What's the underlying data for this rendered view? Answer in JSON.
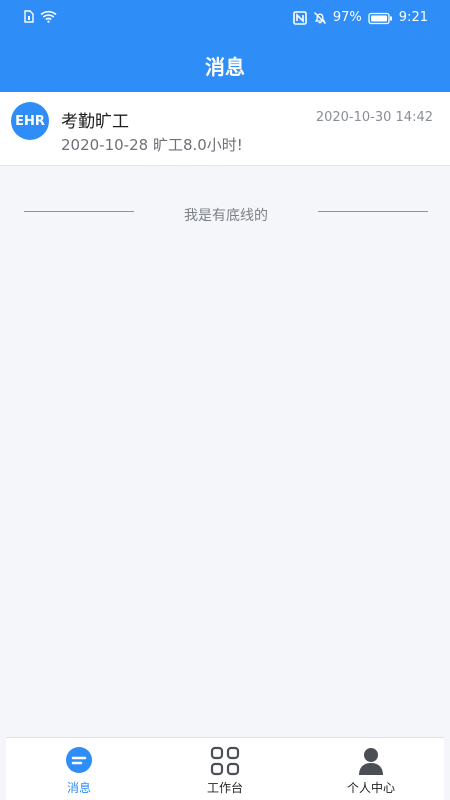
{
  "status_bar": {
    "battery_percent": "97%",
    "time": "9:21"
  },
  "header": {
    "title": "消息"
  },
  "messages": [
    {
      "avatar_text": "EHR",
      "title": "考勤旷工",
      "time": "2020-10-30 14:42",
      "preview": "2020-10-28 旷工8.0小时!"
    }
  ],
  "list_end_text": "我是有底线的",
  "tabs": [
    {
      "label": "消息",
      "icon": "chat-icon",
      "active": true
    },
    {
      "label": "工作台",
      "icon": "grid-icon",
      "active": false
    },
    {
      "label": "个人中心",
      "icon": "user-icon",
      "active": false
    }
  ],
  "colors": {
    "primary": "#2f8df7",
    "background": "#f5f6f9",
    "text": "#1d1d1f",
    "muted": "#8a8e95"
  }
}
